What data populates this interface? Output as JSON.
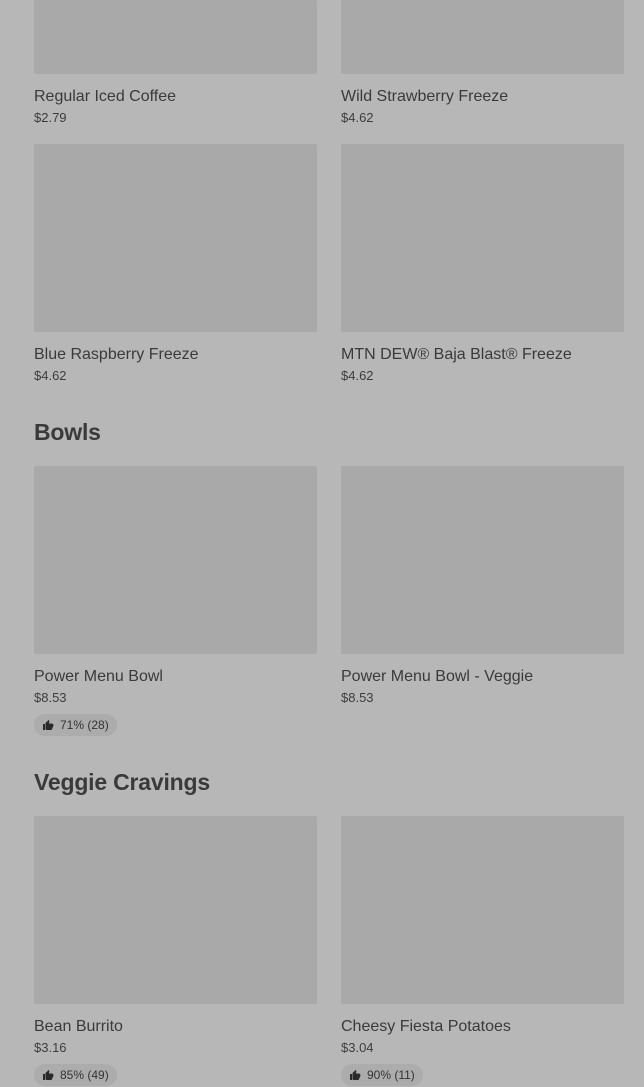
{
  "sections": [
    {
      "title": "",
      "items": [
        {
          "name": "Regular Iced Coffee",
          "price": "$2.79"
        },
        {
          "name": "Wild Strawberry Freeze",
          "price": "$4.62"
        },
        {
          "name": "Blue Raspberry Freeze",
          "price": "$4.62"
        },
        {
          "name": "MTN DEW® Baja Blast® Freeze",
          "price": "$4.62"
        }
      ]
    },
    {
      "title": "Bowls",
      "items": [
        {
          "name": "Power Menu Bowl",
          "price": "$8.53",
          "rating": "71% (28)"
        },
        {
          "name": "Power Menu Bowl - Veggie",
          "price": "$8.53"
        }
      ]
    },
    {
      "title": "Veggie Cravings",
      "items": [
        {
          "name": "Bean Burrito",
          "price": "$3.16",
          "rating": "85% (49)"
        },
        {
          "name": "Cheesy Fiesta Potatoes",
          "price": "$3.04",
          "rating": "90% (11)"
        }
      ]
    }
  ],
  "icons": {
    "rating": "thumbs-up-icon"
  },
  "colors": {
    "background": "#b7b7b7",
    "thumbnail": "#a9a9a9",
    "badge": "#acacac"
  }
}
